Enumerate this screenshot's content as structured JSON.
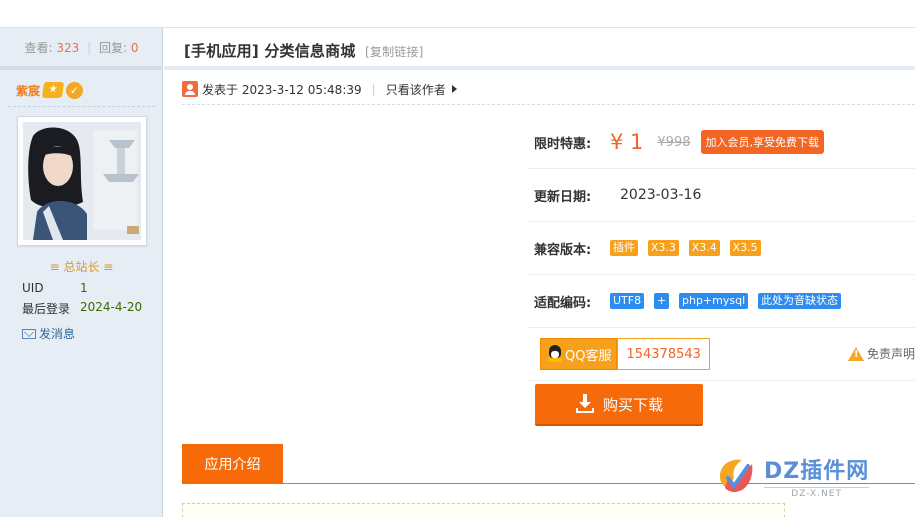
{
  "stats": {
    "views_label": "查看:",
    "views_count": "323",
    "separator": "|",
    "replies_label": "回复:",
    "replies_count": "0"
  },
  "author": {
    "name": "紫宸",
    "rank": "≡ 总站长 ≡",
    "uid_label": "UID",
    "uid_value": "1",
    "last_login_label": "最后登录",
    "last_login_value": "2024-4-20",
    "pm_label": "发消息"
  },
  "post": {
    "title": "[手机应用] 分类信息商城",
    "copy_link": "[复制链接]",
    "posted_at": "发表于 2023-3-12 05:48:39",
    "separator": "|",
    "author_only": "只看该作者"
  },
  "product": {
    "price_label": "限时特惠:",
    "price": "¥ 1",
    "old_price": "¥998",
    "vip_badge": "加入会员,享受免费下载",
    "update_label": "更新日期:",
    "update_value": "2023-03-16",
    "compat_label": "兼容版本:",
    "compat_tags": [
      "插件",
      "X3.3",
      "X3.4",
      "X3.5"
    ],
    "encoding_label": "适配编码:",
    "encoding_tags": [
      "UTF8",
      "+",
      "php+mysql",
      "此处为音缺状态"
    ],
    "qq_label": "QQ客服",
    "qq_number": "154378543",
    "disclaimer": "免责声明",
    "buy_button": "购买下载"
  },
  "tabs": {
    "active": "应用介绍"
  },
  "watermark": {
    "title": "DZ插件网",
    "subtitle": "DZ-X.NET"
  },
  "colors": {
    "accent": "#f66a0a",
    "tag_orange": "#f7a01b",
    "tag_blue": "#2d8cf0",
    "sidebar_bg": "#e6edf4",
    "price_red": "#f26522"
  },
  "icons": [
    "crown-icon",
    "verified-icon",
    "mail-icon",
    "user-icon",
    "caret-right-icon",
    "qq-icon",
    "warning-icon",
    "download-icon",
    "dz-logo-icon"
  ]
}
